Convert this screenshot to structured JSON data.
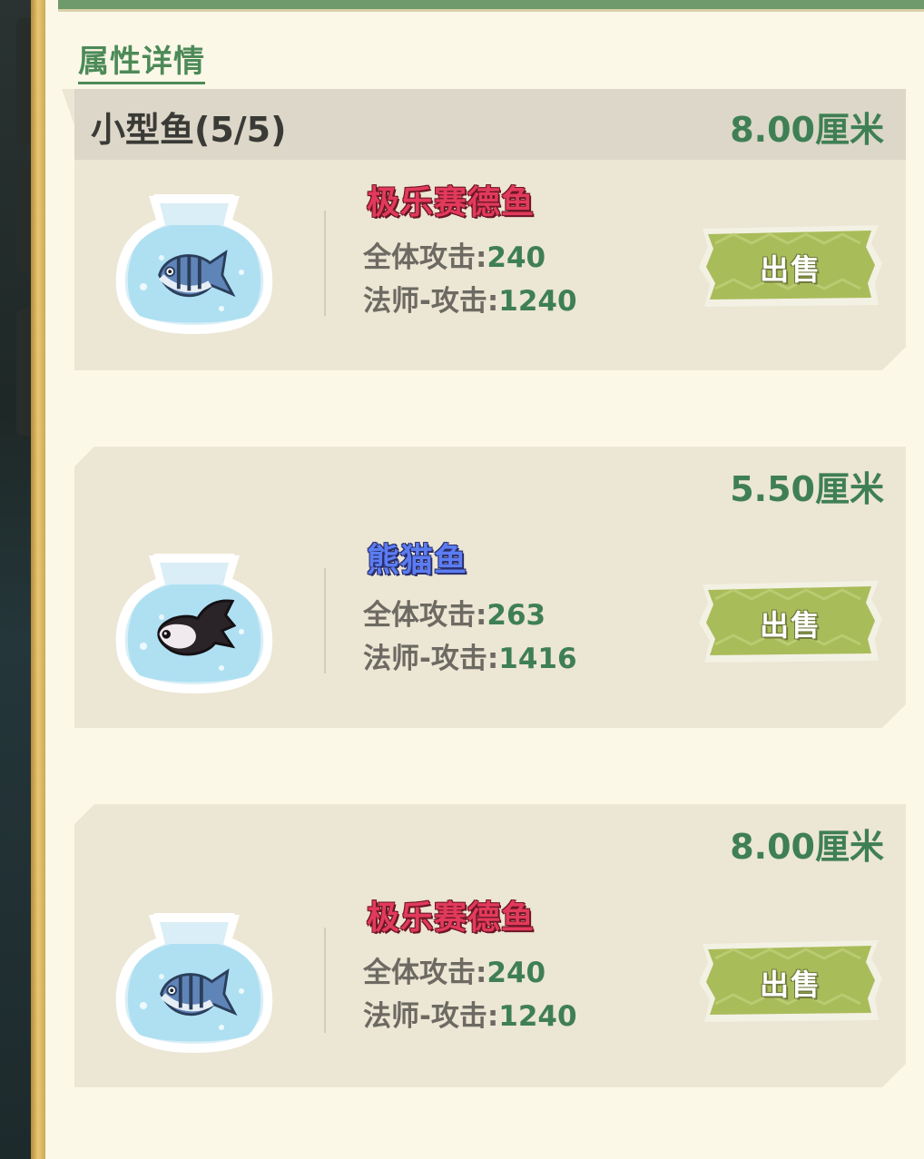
{
  "section_title": "属性详情",
  "category": {
    "name": "小型鱼(5/5)"
  },
  "stat_labels": {
    "all_attack": "全体攻击:",
    "mage_attack": "法师-攻击:"
  },
  "fish": [
    {
      "size": "8.00厘米",
      "name": "极乐赛德鱼",
      "name_color": "red",
      "fish_icon": "blue-striped-fish-icon",
      "all_attack": "240",
      "mage_attack": "1240",
      "sell_label": "出售"
    },
    {
      "size": "5.50厘米",
      "name": "熊猫鱼",
      "name_color": "blue",
      "fish_icon": "panda-fish-icon",
      "all_attack": "263",
      "mage_attack": "1416",
      "sell_label": "出售"
    },
    {
      "size": "8.00厘米",
      "name": "极乐赛德鱼",
      "name_color": "red",
      "fish_icon": "blue-striped-fish-icon",
      "all_attack": "240",
      "mage_attack": "1240",
      "sell_label": "出售"
    }
  ],
  "colors": {
    "value_green": "#3f7f55",
    "rare_red": "#e23a5b",
    "rare_blue": "#5b7df2",
    "sell_green": "#a9bc5a"
  }
}
